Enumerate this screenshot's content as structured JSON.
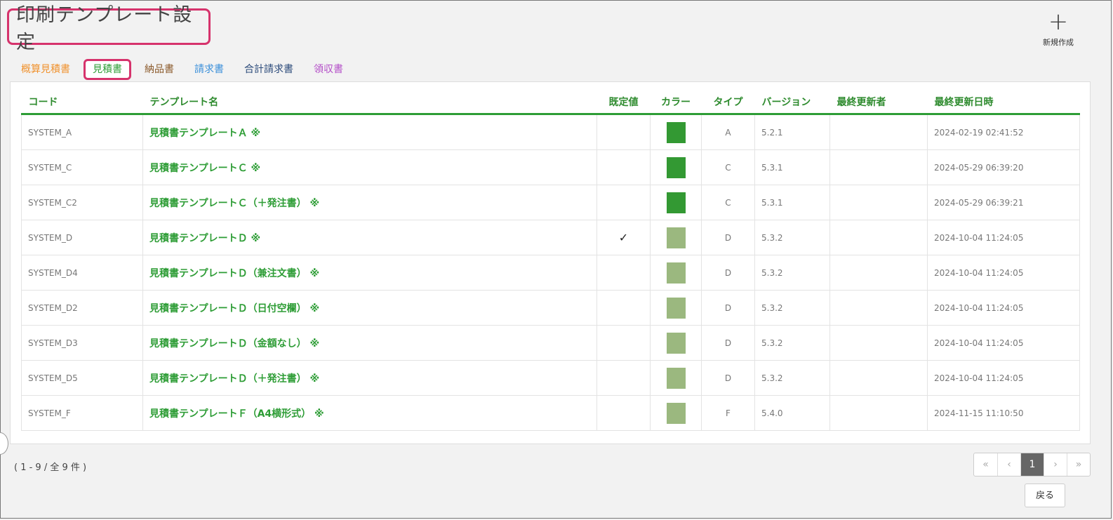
{
  "header": {
    "title": "印刷テンプレート設定",
    "new_label": "新規作成"
  },
  "tabs": [
    {
      "label": "概算見積書",
      "color": "#f0922e"
    },
    {
      "label": "見積書",
      "color": "#2e9d36",
      "active": true
    },
    {
      "label": "納品書",
      "color": "#8b5a2b"
    },
    {
      "label": "請求書",
      "color": "#3a8fd9"
    },
    {
      "label": "合計請求書",
      "color": "#2b4a7a"
    },
    {
      "label": "領収書",
      "color": "#b44fc8"
    }
  ],
  "table": {
    "columns": [
      "コード",
      "テンプレート名",
      "既定値",
      "カラー",
      "タイプ",
      "バージョン",
      "最終更新者",
      "最終更新日時"
    ],
    "rows": [
      {
        "code": "SYSTEM_A",
        "name": "見積書テンプレートＡ ※",
        "default": "",
        "color": "#339933",
        "type": "A",
        "version": "5.2.1",
        "updater": "",
        "updated": "2024-02-19 02:41:52"
      },
      {
        "code": "SYSTEM_C",
        "name": "見積書テンプレートＣ ※",
        "default": "",
        "color": "#339933",
        "type": "C",
        "version": "5.3.1",
        "updater": "",
        "updated": "2024-05-29 06:39:20"
      },
      {
        "code": "SYSTEM_C2",
        "name": "見積書テンプレートＣ（＋発注書） ※",
        "default": "",
        "color": "#339933",
        "type": "C",
        "version": "5.3.1",
        "updater": "",
        "updated": "2024-05-29 06:39:21"
      },
      {
        "code": "SYSTEM_D",
        "name": "見積書テンプレートＤ ※",
        "default": "✓",
        "color": "#9bb87f",
        "type": "D",
        "version": "5.3.2",
        "updater": "",
        "updated": "2024-10-04 11:24:05"
      },
      {
        "code": "SYSTEM_D4",
        "name": "見積書テンプレートＤ（兼注文書） ※",
        "default": "",
        "color": "#9bb87f",
        "type": "D",
        "version": "5.3.2",
        "updater": "",
        "updated": "2024-10-04 11:24:05"
      },
      {
        "code": "SYSTEM_D2",
        "name": "見積書テンプレートＤ（日付空欄） ※",
        "default": "",
        "color": "#9bb87f",
        "type": "D",
        "version": "5.3.2",
        "updater": "",
        "updated": "2024-10-04 11:24:05"
      },
      {
        "code": "SYSTEM_D3",
        "name": "見積書テンプレートＤ（金額なし） ※",
        "default": "",
        "color": "#9bb87f",
        "type": "D",
        "version": "5.3.2",
        "updater": "",
        "updated": "2024-10-04 11:24:05"
      },
      {
        "code": "SYSTEM_D5",
        "name": "見積書テンプレートＤ（＋発注書） ※",
        "default": "",
        "color": "#9bb87f",
        "type": "D",
        "version": "5.3.2",
        "updater": "",
        "updated": "2024-10-04 11:24:05"
      },
      {
        "code": "SYSTEM_F",
        "name": "見積書テンプレートＦ（A4横形式） ※",
        "default": "",
        "color": "#9bb87f",
        "type": "F",
        "version": "5.4.0",
        "updater": "",
        "updated": "2024-11-15 11:10:50"
      }
    ]
  },
  "footer": {
    "count": "( 1 - 9 / 全 9 件 )",
    "pager": [
      "«",
      "‹",
      "1",
      "›",
      "»"
    ],
    "back_label": "戻る"
  }
}
